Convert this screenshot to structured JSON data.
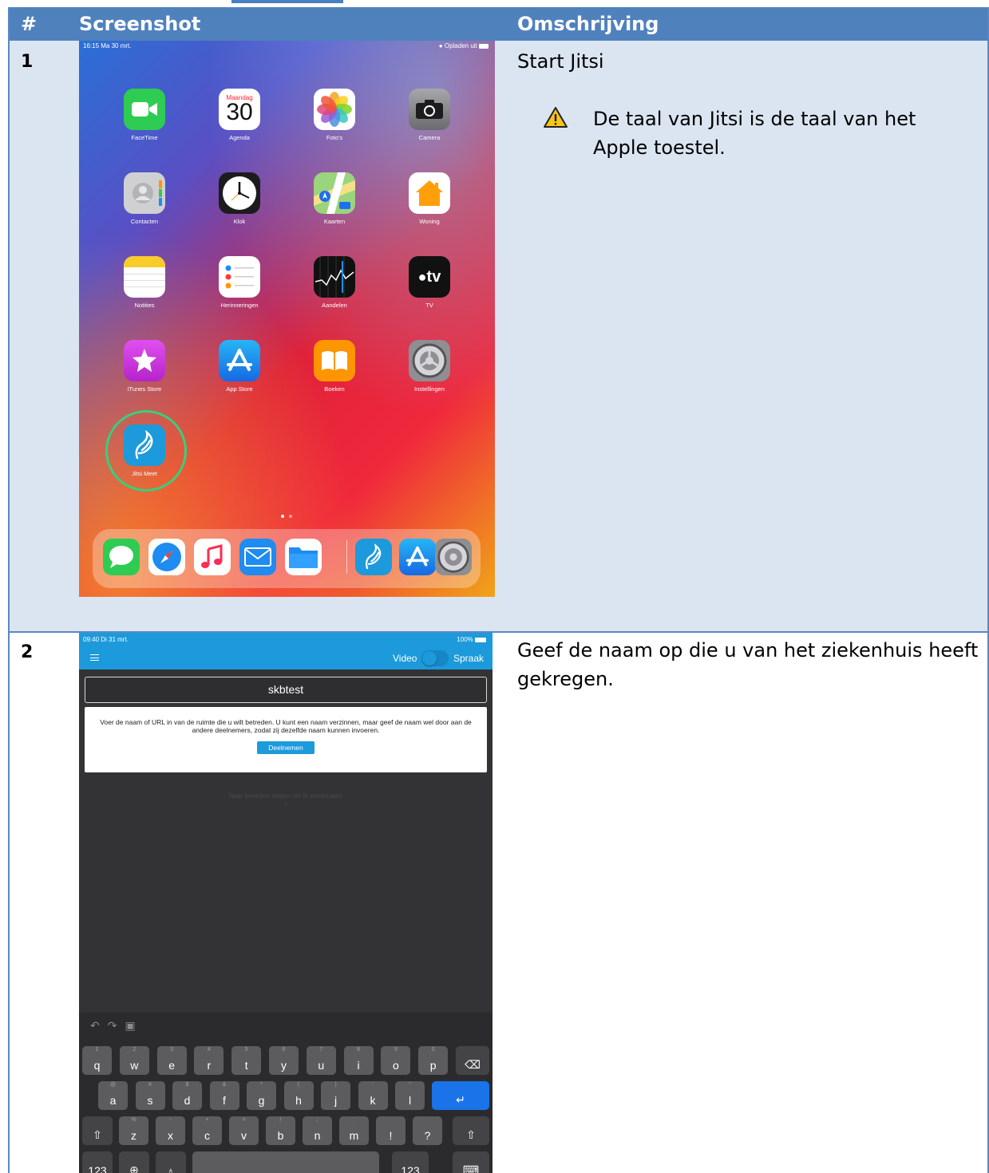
{
  "table": {
    "headers": [
      "#",
      "Screenshot",
      "Omschrijving"
    ],
    "rows": [
      {
        "num": "1",
        "description": "Start Jitsi",
        "warning": "De taal van Jitsi is de taal van het Apple toestel."
      },
      {
        "num": "2",
        "description": "Geef de naam op die u van het ziekenhuis heeft gekregen."
      }
    ]
  },
  "home_screen": {
    "status_left": "16:15  Ma 30 mrt.",
    "status_right": "Opladen uit",
    "calendar_day": "Maandag",
    "calendar_date": "30",
    "apps": [
      {
        "label": "FaceTime",
        "icon": "facetime-icon",
        "color": "#2ecc52"
      },
      {
        "label": "Agenda",
        "icon": "calendar-icon",
        "color": "#ffffff"
      },
      {
        "label": "Foto's",
        "icon": "photos-icon",
        "color": "#ffffff"
      },
      {
        "label": "Camera",
        "icon": "camera-icon",
        "color": "#8e8e93"
      },
      {
        "label": "Contacten",
        "icon": "contacts-icon",
        "color": "#c9c9cc"
      },
      {
        "label": "Klok",
        "icon": "clock-icon",
        "color": "#1c1c1e"
      },
      {
        "label": "Kaarten",
        "icon": "maps-icon",
        "color": "#8fd27b"
      },
      {
        "label": "Woning",
        "icon": "home-icon",
        "color": "#ffffff"
      },
      {
        "label": "Notities",
        "icon": "notes-icon",
        "color": "#ffffff"
      },
      {
        "label": "Herinneringen",
        "icon": "reminders-icon",
        "color": "#ffffff"
      },
      {
        "label": "Aandelen",
        "icon": "stocks-icon",
        "color": "#111111"
      },
      {
        "label": "TV",
        "icon": "tv-icon",
        "color": "#111111"
      },
      {
        "label": "iTunes Store",
        "icon": "itunes-store-icon",
        "color": "#d63fe0"
      },
      {
        "label": "App Store",
        "icon": "app-store-icon",
        "color": "#1e8cf0"
      },
      {
        "label": "Boeken",
        "icon": "books-icon",
        "color": "#ff9500"
      },
      {
        "label": "Instellingen",
        "icon": "settings-icon",
        "color": "#8e8e93"
      },
      {
        "label": "Jitsi Meet",
        "icon": "jitsi-meet-icon",
        "color": "#1c9adb"
      }
    ],
    "tv_text": "tv",
    "dock": [
      "messages-icon",
      "safari-icon",
      "music-icon",
      "mail-icon",
      "files-icon",
      "jitsi-meet-icon",
      "app-store-icon",
      "settings-icon"
    ]
  },
  "jitsi_screen": {
    "status_left": "09:40  Di 31 mrt.",
    "status_right": "100%",
    "video_label": "Video",
    "voice_label": "Spraak",
    "room_name": "skbtest",
    "info_text": "Voer de naam of URL in van de ruimte die u wilt betreden. U kunt een naam verzinnen, maar geef de naam wel door aan de andere deelnemers, zodat zij dezelfde naam kunnen invoeren.",
    "join_label": "Deelnemen",
    "pull_hint": "Naar beneden slepen om te vernieuwen",
    "keyboard": {
      "row1": [
        [
          "1",
          "q"
        ],
        [
          "2",
          "w"
        ],
        [
          "3",
          "e"
        ],
        [
          "4",
          "r"
        ],
        [
          "5",
          "t"
        ],
        [
          "6",
          "y"
        ],
        [
          "7",
          "u"
        ],
        [
          "8",
          "i"
        ],
        [
          "9",
          "o"
        ],
        [
          "0",
          "p"
        ]
      ],
      "row2": [
        [
          "@",
          "a"
        ],
        [
          "#",
          "s"
        ],
        [
          "$",
          "d"
        ],
        [
          "&",
          "f"
        ],
        [
          "*",
          "g"
        ],
        [
          "(",
          "h"
        ],
        [
          ")",
          "j"
        ],
        [
          "'",
          "k"
        ],
        [
          "\"",
          "l"
        ]
      ],
      "row3": [
        [
          "%",
          "z"
        ],
        [
          "-",
          "x"
        ],
        [
          "+",
          "c"
        ],
        [
          "=",
          "v"
        ],
        [
          "/",
          "b"
        ],
        [
          ";",
          "n"
        ],
        [
          ":",
          "m"
        ],
        [
          "",
          "!"
        ],
        [
          "",
          "?"
        ]
      ],
      "num_label": "123"
    }
  }
}
